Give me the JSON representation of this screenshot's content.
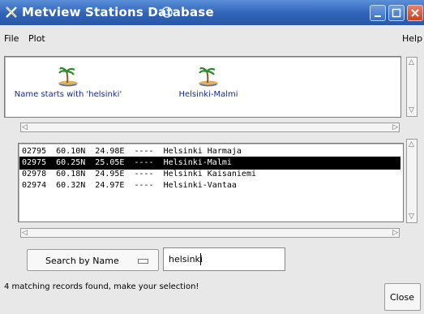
{
  "window": {
    "title": "Metview Stations Database",
    "controls": [
      "minimize-icon",
      "maximize-icon",
      "close-icon"
    ]
  },
  "menubar": {
    "file": "File",
    "plot": "Plot",
    "help": "Help"
  },
  "icons": [
    {
      "label": "Name starts with 'helsinki'",
      "icon": "island-icon"
    },
    {
      "label": "Helsinki-Malmi",
      "icon": "island-icon"
    }
  ],
  "stations": [
    {
      "text": "02795  60.10N  24.98E  ----  Helsinki Harmaja",
      "selected": false
    },
    {
      "text": "02975  60.25N  25.05E  ----  Helsinki-Malmi",
      "selected": true
    },
    {
      "text": "02978  60.18N  24.95E  ----  Helsinki Kaisaniemi",
      "selected": false
    },
    {
      "text": "02974  60.32N  24.97E  ----  Helsinki-Vantaa",
      "selected": false
    }
  ],
  "search": {
    "mode_label": "Search by Name",
    "value": "helsinki"
  },
  "status": "4 matching records found, make your selection!",
  "close_label": "Close",
  "colors": {
    "titlebar": "#2f63b8",
    "selection": "#000000",
    "icon_label": "#1a2a8a"
  }
}
